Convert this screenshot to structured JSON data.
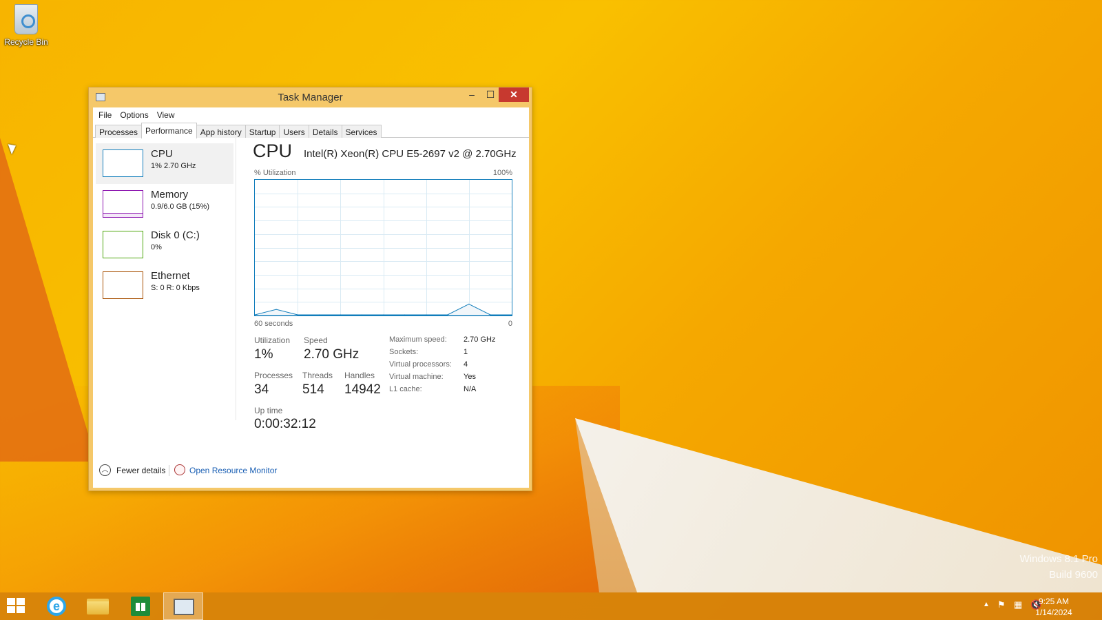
{
  "desktop": {
    "icons": [
      {
        "label": "Recycle Bin",
        "icon": "recycle-bin-icon"
      }
    ],
    "watermark": {
      "line1": "Windows 8.1 Pro",
      "line2": "Build 9600"
    }
  },
  "window": {
    "title": "Task Manager",
    "controls": {
      "minimize": "–",
      "maximize": "☐",
      "close": "✕"
    },
    "menu": [
      "File",
      "Options",
      "View"
    ],
    "tabs": [
      "Processes",
      "Performance",
      "App history",
      "Startup",
      "Users",
      "Details",
      "Services"
    ],
    "active_tab": "Performance",
    "sidebar": [
      {
        "name": "CPU",
        "sub": "1%  2.70 GHz",
        "color": "#117dbb"
      },
      {
        "name": "Memory",
        "sub": "0.9/6.0 GB (15%)",
        "color": "#8b12ae"
      },
      {
        "name": "Disk 0 (C:)",
        "sub": "0%",
        "color": "#4da60c"
      },
      {
        "name": "Ethernet",
        "sub": "S: 0 R: 0 Kbps",
        "color": "#a74f01"
      }
    ],
    "cpu": {
      "title": "CPU",
      "model": "Intel(R) Xeon(R) CPU E5-2697 v2 @ 2.70GHz",
      "util_label": "% Utilization",
      "util_max": "100%",
      "time_label": "60 seconds",
      "time_end": "0",
      "stats": {
        "utilization": {
          "label": "Utilization",
          "value": "1%"
        },
        "speed": {
          "label": "Speed",
          "value": "2.70 GHz"
        },
        "processes": {
          "label": "Processes",
          "value": "34"
        },
        "threads": {
          "label": "Threads",
          "value": "514"
        },
        "handles": {
          "label": "Handles",
          "value": "14942"
        },
        "uptime": {
          "label": "Up time",
          "value": "0:00:32:12"
        }
      },
      "details": [
        {
          "label": "Maximum speed:",
          "value": "2.70 GHz"
        },
        {
          "label": "Sockets:",
          "value": "1"
        },
        {
          "label": "Virtual processors:",
          "value": "4"
        },
        {
          "label": "Virtual machine:",
          "value": "Yes"
        },
        {
          "label": "L1 cache:",
          "value": "N/A"
        }
      ]
    },
    "footer": {
      "fewer_details": "Fewer details",
      "resource_monitor": "Open Resource Monitor"
    }
  },
  "chart_data": {
    "type": "area",
    "x": [
      60,
      55,
      50,
      45,
      40,
      35,
      30,
      25,
      20,
      15,
      10,
      5,
      0
    ],
    "series": [
      {
        "values": [
          0,
          1,
          0,
          0,
          0,
          0,
          0,
          0,
          0,
          0,
          2,
          0,
          0
        ]
      }
    ],
    "ylim": [
      0,
      100
    ],
    "grid": true,
    "color": "#117dbb"
  },
  "taskbar": {
    "items": [
      "start-icon",
      "internet-explorer-icon",
      "file-explorer-icon",
      "store-icon",
      "task-manager-icon"
    ],
    "clock": {
      "time": "9:25 AM",
      "date": "1/14/2024"
    },
    "tray": [
      "show-hidden-icons-icon",
      "action-center-flag-icon",
      "network-icon",
      "volume-muted-icon"
    ]
  }
}
